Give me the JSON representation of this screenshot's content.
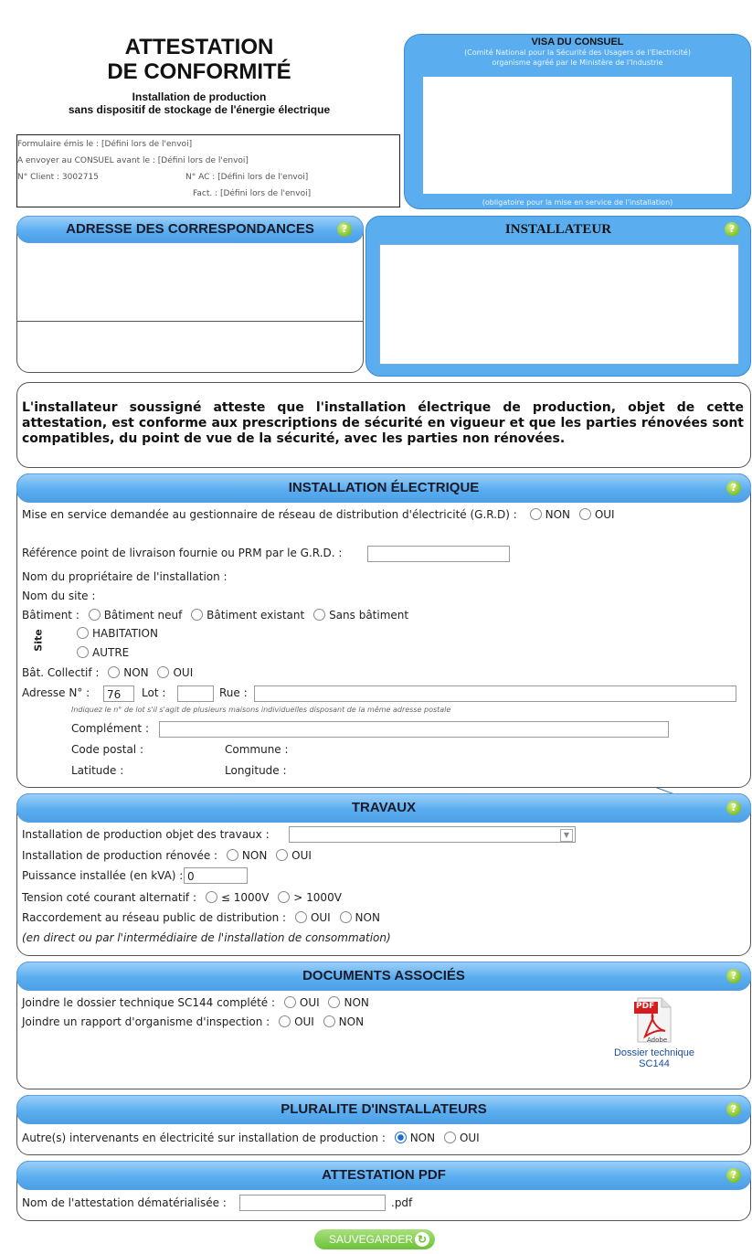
{
  "title": {
    "line1": "ATTESTATION",
    "line2": "DE CONFORMITÉ",
    "sub1": "Installation de production",
    "sub2": "sans dispositif de stockage de l'énergie électrique"
  },
  "info": {
    "emis": "Formulaire émis le :  [Défini lors de l'envoi]",
    "envoyer": "A envoyer au CONSUEL avant le :  [Défini lors de l'envoi]",
    "client": "N° Client :  3002715",
    "ac": "N° AC :  [Défini lors de l'envoi]",
    "fact": "Fact. :  [Défini lors de l'envoi]"
  },
  "visa": {
    "title": "VISA DU CONSUEL",
    "sub1": "(Comité National pour la Sécurité des Usagers de l'Electricité)",
    "sub2": "organisme agréé par le Ministère de l'Industrie",
    "footer": "(obligatoire pour la mise en service de l'installation)"
  },
  "correspondances": {
    "title": "ADRESSE DES CORRESPONDANCES"
  },
  "installateur": {
    "title": "INSTALLATEUR"
  },
  "statement": "L'installateur soussigné atteste que l'installation électrique de production, objet de cette attestation, est conforme aux prescriptions de sécurité en vigueur et que les parties rénovées sont compatibles, du point de vue de la sécurité, avec les parties non rénovées.",
  "help_glyph": "?",
  "elec": {
    "title": "INSTALLATION ÉLECTRIQUE",
    "mise_service": "Mise en service demandée au gestionnaire de réseau de distribution d'électricité (G.R.D) :",
    "non": "NON",
    "oui": "OUI",
    "reference": "Référence point de livraison fournie ou PRM par le G.R.D. :",
    "proprietaire": "Nom du propriétaire de l'installation :",
    "site": "Nom du site :",
    "batiment": "Bâtiment :",
    "bat_neuf": "Bâtiment neuf",
    "bat_existant": "Bâtiment existant",
    "sans_batiment": "Sans bâtiment",
    "site_label": "Site",
    "habitation": "HABITATION",
    "autre": "AUTRE",
    "collectif": "Bât. Collectif :",
    "adresse": "Adresse  N° :",
    "numero": "76",
    "lot": "Lot :",
    "rue": "Rue :",
    "hint": "Indiquez le n° de lot s'il s'agit de plusieurs maisons individuelles disposant de la même adresse postale",
    "complement": "Complément :",
    "code_postal": "Code postal :",
    "commune": "Commune :",
    "latitude": "Latitude :",
    "longitude": "Longitude :"
  },
  "travaux": {
    "title": "TRAVAUX",
    "objet": "Installation de production objet des travaux :",
    "renovee": "Installation de production rénovée :",
    "puissance": "Puissance installée (en kVA) :",
    "puissance_value": "0",
    "tension": "Tension coté courant alternatif :",
    "le1000": "≤ 1000V",
    "gt1000": "> 1000V",
    "raccordement": "Raccordement au réseau public de distribution :",
    "note": "(en direct ou par l'intermédiaire de l'installation de consommation)"
  },
  "documents": {
    "title": "DOCUMENTS ASSOCIÉS",
    "sc144": "Joindre le dossier technique SC144 complété :",
    "rapport": "Joindre un rapport d'organisme d'inspection :",
    "pdf_badge": "PDF",
    "adobe": "Adobe",
    "link1": "Dossier technique",
    "link2": "SC144"
  },
  "pluralite": {
    "title": "PLURALITE D'INSTALLATEURS",
    "question": "Autre(s) intervenants en électricité sur installation de production :"
  },
  "pdf": {
    "title": "ATTESTATION PDF",
    "label": "Nom de l'attestation dématérialisée :",
    "ext": ".pdf"
  },
  "save": {
    "label": "SAUVEGARDER",
    "icon": "↻"
  },
  "colors": {
    "accent": "#5aaef0",
    "help": "#7fbf2a",
    "save": "#6cc238"
  }
}
